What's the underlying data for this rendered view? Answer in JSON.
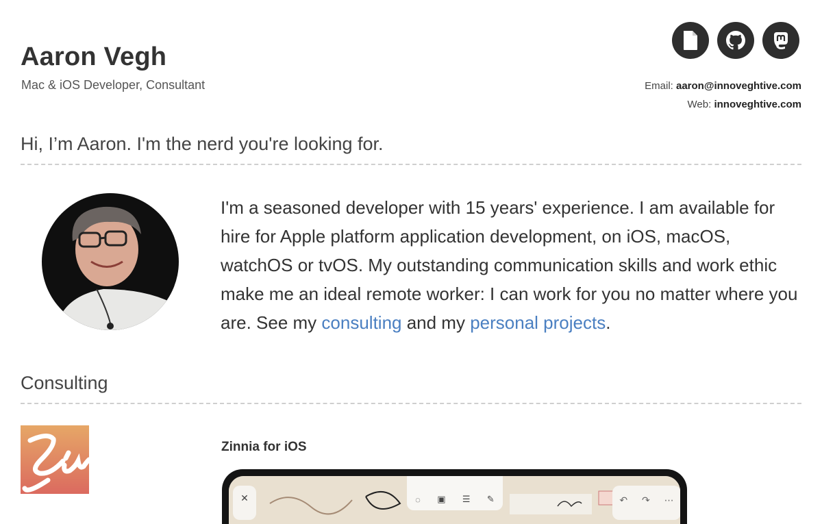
{
  "header": {
    "name": "Aaron Vegh",
    "subtitle": "Mac & iOS Developer, Consultant",
    "icons": [
      "document-icon",
      "github-icon",
      "mastodon-icon"
    ],
    "email_label": "Email:",
    "email_value": "aaron@innoveghtive.com",
    "web_label": "Web:",
    "web_value": "innoveghtive.com"
  },
  "intro": {
    "heading": "Hi, I’m Aaron. I'm the nerd you're looking for.",
    "text_before": "I'm a seasoned developer with 15 years' experience. I am available for hire for Apple platform application development, on iOS, macOS, watchOS or tvOS. My outstanding communication skills and work ethic make me an ideal remote worker: I can work for you no matter where you are. See my ",
    "link_consulting": "consulting",
    "text_middle": " and my ",
    "link_projects": "personal projects",
    "text_after": "."
  },
  "consulting": {
    "heading": "Consulting",
    "app_title": "Zinnia for iOS"
  },
  "colors": {
    "link": "#4a7fc1",
    "icon_bg": "#2e2e2e",
    "text": "#333333"
  }
}
